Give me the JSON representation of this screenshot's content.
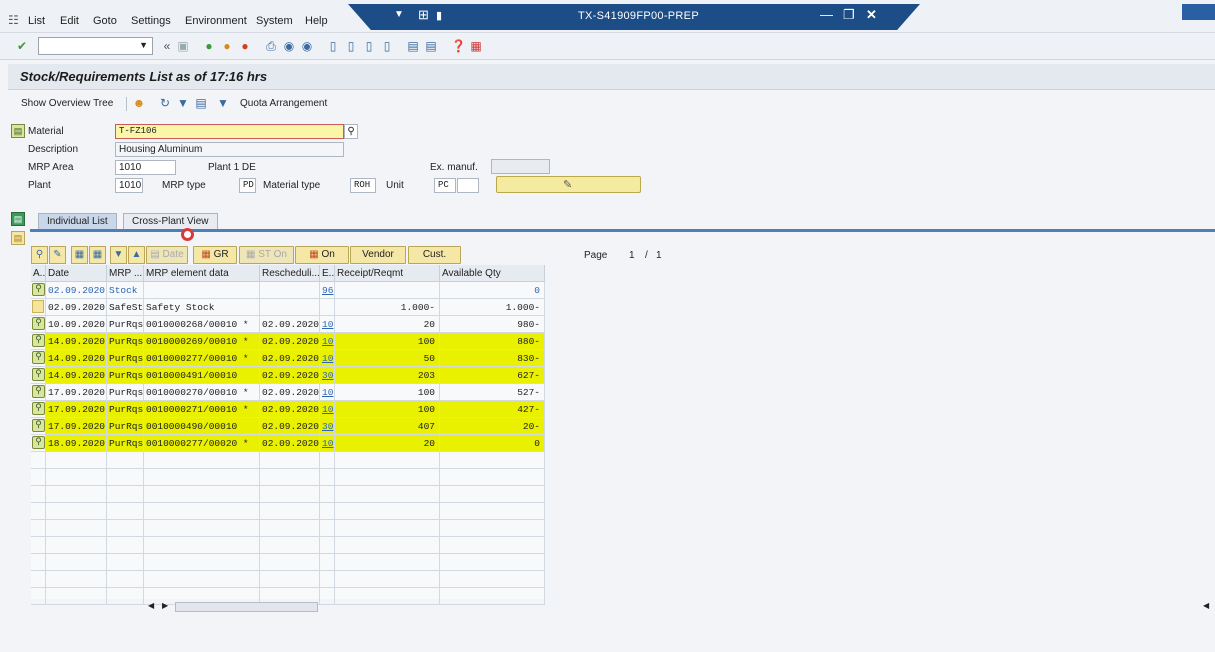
{
  "menubar": {
    "items": [
      "List",
      "Edit",
      "Goto",
      "Settings",
      "Environment",
      "System",
      "Help"
    ],
    "window_title": "TX-S41909FP00-PREP"
  },
  "toolbar": {
    "command_value": "",
    "icons": [
      "enter-icon",
      "back-icon",
      "save-icon",
      "exit-icon",
      "cancel-icon",
      "print-icon",
      "find-icon",
      "find-next-icon",
      "first-page-icon",
      "prev-page-icon",
      "next-page-icon",
      "last-page-icon",
      "new-session-icon",
      "shortcut-icon",
      "help-icon",
      "customize-icon"
    ]
  },
  "page": {
    "title": "Stock/Requirements List as of 17:16 hrs"
  },
  "app_toolbar": {
    "show_overview_tree": "Show Overview Tree",
    "quota_arrangement": "Quota Arrangement"
  },
  "header_form": {
    "material_label": "Material",
    "material_value": "T-FZ106",
    "description_label": "Description",
    "description_value": "Housing Aluminum",
    "mrp_area_label": "MRP Area",
    "mrp_area_value": "1010",
    "mrp_area_text": "Plant 1 DE",
    "ex_manuf_label": "Ex. manuf.",
    "ex_manuf_value": "",
    "plant_label": "Plant",
    "plant_value": "1010",
    "mrp_type_label": "MRP type",
    "mrp_type_value": "PD",
    "material_type_label": "Material type",
    "material_type_value": "ROH",
    "unit_label": "Unit",
    "unit_value": "PC"
  },
  "tabs": [
    {
      "label": "Individual List",
      "active": true
    },
    {
      "label": "Cross-Plant View",
      "active": false
    }
  ],
  "grid_toolbar": {
    "date": "Date",
    "gr": "GR",
    "st_on": "ST On",
    "on": "On",
    "vendor": "Vendor",
    "cust": "Cust.",
    "page_label": "Page",
    "page_current": "1",
    "page_sep": "/",
    "page_total": "1"
  },
  "table": {
    "columns": [
      "A..",
      "Date",
      "MRP ...",
      "MRP element data",
      "Rescheduli...",
      "E..",
      "Receipt/Reqmt",
      "Available Qty"
    ],
    "rows": [
      {
        "icon": "detail",
        "date": "02.09.2020",
        "mrp": "Stock",
        "data": "",
        "resched": "",
        "e": "96",
        "receipt": "",
        "avail": "0",
        "highlight": false,
        "stock": true
      },
      {
        "icon": "bulb",
        "date": "02.09.2020",
        "mrp": "SafeSt",
        "data": "Safety Stock",
        "resched": "",
        "e": "",
        "receipt": "1.000-",
        "avail": "1.000-",
        "highlight": false,
        "stock": false
      },
      {
        "icon": "detail",
        "date": "10.09.2020",
        "mrp": "PurRqs",
        "data": "0010000268/00010 *",
        "resched": "02.09.2020",
        "e": "10",
        "receipt": "20",
        "avail": "980-",
        "highlight": false,
        "stock": false
      },
      {
        "icon": "detail",
        "date": "14.09.2020",
        "mrp": "PurRqs",
        "data": "0010000269/00010 *",
        "resched": "02.09.2020",
        "e": "10",
        "receipt": "100",
        "avail": "880-",
        "highlight": true,
        "stock": false
      },
      {
        "icon": "detail",
        "date": "14.09.2020",
        "mrp": "PurRqs",
        "data": "0010000277/00010 *",
        "resched": "02.09.2020",
        "e": "10",
        "receipt": "50",
        "avail": "830-",
        "highlight": true,
        "stock": false
      },
      {
        "icon": "detail",
        "date": "14.09.2020",
        "mrp": "PurRqs",
        "data": "0010000491/00010",
        "resched": "02.09.2020",
        "e": "30",
        "receipt": "203",
        "avail": "627-",
        "highlight": true,
        "stock": false
      },
      {
        "icon": "detail",
        "date": "17.09.2020",
        "mrp": "PurRqs",
        "data": "0010000270/00010 *",
        "resched": "02.09.2020",
        "e": "10",
        "receipt": "100",
        "avail": "527-",
        "highlight": false,
        "stock": false
      },
      {
        "icon": "detail",
        "date": "17.09.2020",
        "mrp": "PurRqs",
        "data": "0010000271/00010 *",
        "resched": "02.09.2020",
        "e": "10",
        "receipt": "100",
        "avail": "427-",
        "highlight": true,
        "stock": false
      },
      {
        "icon": "detail",
        "date": "17.09.2020",
        "mrp": "PurRqs",
        "data": "0010000490/00010",
        "resched": "02.09.2020",
        "e": "30",
        "receipt": "407",
        "avail": "20-",
        "highlight": true,
        "stock": false
      },
      {
        "icon": "detail",
        "date": "18.09.2020",
        "mrp": "PurRqs",
        "data": "0010000277/00020 *",
        "resched": "02.09.2020",
        "e": "10",
        "receipt": "20",
        "avail": "0",
        "highlight": true,
        "stock": false
      }
    ],
    "empty_rows": 9
  },
  "colors": {
    "title_bar": "#1d4d86",
    "highlight": "#e9f000",
    "link": "#2a66b3",
    "button_yellow": "#f5e8a6"
  }
}
